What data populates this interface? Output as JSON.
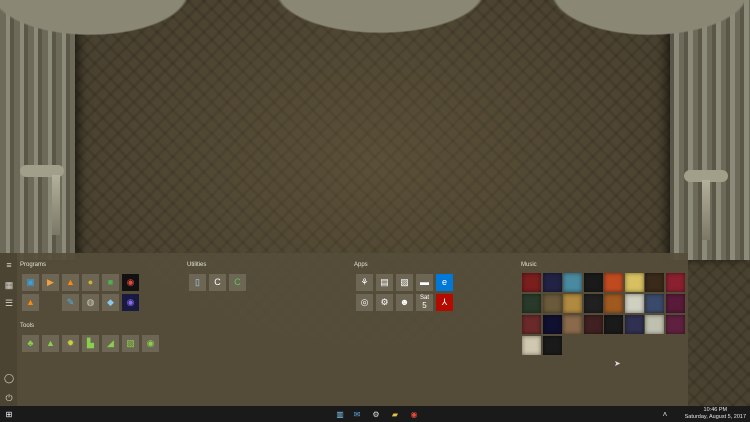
{
  "start_menu": {
    "groups": {
      "programs": "Programs",
      "utilities": "Utilities",
      "apps": "Apps",
      "tools": "Tools",
      "music": "Music"
    },
    "calendar": {
      "weekday": "Sat",
      "day": "5"
    }
  },
  "taskbar": {
    "clock_time": "10:46 PM",
    "clock_date": "Saturday, August 5, 2017"
  },
  "colors": {
    "accent_edge": "#0078d7",
    "acrobat": "#b30b00",
    "chrome_bg": "#1a1a1a",
    "tile_gray": "#6d6654",
    "tool_green": "#6fa83a"
  },
  "icons": {
    "programs": [
      "photo-editor-icon",
      "media-player-icon",
      "vlc-icon",
      "ball-icon",
      "green-app-icon",
      "chrome-icon",
      "vlc-small-icon",
      "feather-icon",
      "turtle-icon",
      "box-icon",
      "firefox-icon"
    ],
    "utilities": [
      "disk-utility-icon",
      "ccleaner-icon",
      "ccleaner-green-icon"
    ],
    "apps": [
      "tree-icon",
      "store-icon",
      "photos-icon",
      "movies-icon",
      "edge-icon",
      "cortana-icon",
      "settings-icon",
      "alien-icon",
      "calendar-icon",
      "acrobat-icon"
    ],
    "tools": [
      "tool-1-icon",
      "tool-2-icon",
      "tool-3-icon",
      "tool-4-icon",
      "tool-5-icon",
      "tool-6-icon",
      "tool-7-icon"
    ]
  }
}
